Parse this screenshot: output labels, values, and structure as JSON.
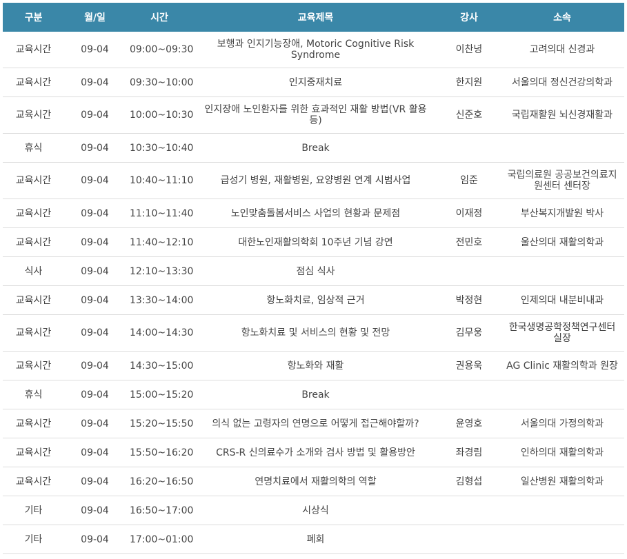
{
  "table": {
    "headers": [
      "구분",
      "월/일",
      "시간",
      "교육제목",
      "강사",
      "소속"
    ],
    "rows": [
      {
        "type": "교육시간",
        "date": "09-04",
        "time": "09:00~09:30",
        "title": "보행과 인지기능장애, Motoric Cognitive Risk Syndrome",
        "speaker": "이찬녕",
        "affiliation": "고려의대 신경과"
      },
      {
        "type": "교육시간",
        "date": "09-04",
        "time": "09:30~10:00",
        "title": "인지중재치료",
        "speaker": "한지원",
        "affiliation": "서울의대 정신건강의학과"
      },
      {
        "type": "교육시간",
        "date": "09-04",
        "time": "10:00~10:30",
        "title": "인지장애 노인환자를 위한 효과적인 재활 방법(VR 활용 등)",
        "speaker": "신준호",
        "affiliation": "국립재활원 뇌신경재활과"
      },
      {
        "type": "휴식",
        "date": "09-04",
        "time": "10:30~10:40",
        "title": "Break",
        "speaker": "",
        "affiliation": ""
      },
      {
        "type": "교육시간",
        "date": "09-04",
        "time": "10:40~11:10",
        "title": "급성기 병원, 재활병원, 요양병원 연계 시범사업",
        "speaker": "임준",
        "affiliation": "국립의료원 공공보건의료지원센터 센터장"
      },
      {
        "type": "교육시간",
        "date": "09-04",
        "time": "11:10~11:40",
        "title": "노인맞춤돌봄서비스 사업의 현황과 문제점",
        "speaker": "이재정",
        "affiliation": "부산복지개발원 박사"
      },
      {
        "type": "교육시간",
        "date": "09-04",
        "time": "11:40~12:10",
        "title": "대한노인재활의학회 10주년 기념 강연",
        "speaker": "전민호",
        "affiliation": "울산의대 재활의학과"
      },
      {
        "type": "식사",
        "date": "09-04",
        "time": "12:10~13:30",
        "title": "점심 식사",
        "speaker": "",
        "affiliation": ""
      },
      {
        "type": "교육시간",
        "date": "09-04",
        "time": "13:30~14:00",
        "title": "항노화치료, 임상적 근거",
        "speaker": "박정현",
        "affiliation": "인제의대 내분비내과"
      },
      {
        "type": "교육시간",
        "date": "09-04",
        "time": "14:00~14:30",
        "title": "항노화치료 및 서비스의 현황 및 전망",
        "speaker": "김무웅",
        "affiliation": "한국생명공학정책연구센터 실장"
      },
      {
        "type": "교육시간",
        "date": "09-04",
        "time": "14:30~15:00",
        "title": "항노화와 재활",
        "speaker": "권용욱",
        "affiliation": "AG Clinic 재활의학과 원장"
      },
      {
        "type": "휴식",
        "date": "09-04",
        "time": "15:00~15:20",
        "title": "Break",
        "speaker": "",
        "affiliation": ""
      },
      {
        "type": "교육시간",
        "date": "09-04",
        "time": "15:20~15:50",
        "title": "의식 없는 고령자의 연명으로 어떻게 접근해야할까?",
        "speaker": "윤영호",
        "affiliation": "서울의대 가정의학과"
      },
      {
        "type": "교육시간",
        "date": "09-04",
        "time": "15:50~16:20",
        "title": "CRS-R 신의료수가 소개와 검사 방법 및 활용방안",
        "speaker": "좌경림",
        "affiliation": "인하의대 재활의학과"
      },
      {
        "type": "교육시간",
        "date": "09-04",
        "time": "16:20~16:50",
        "title": "연명치료에서 재활의학의 역할",
        "speaker": "김형섭",
        "affiliation": "일산병원 재활의학과"
      },
      {
        "type": "기타",
        "date": "09-04",
        "time": "16:50~17:00",
        "title": "시상식",
        "speaker": "",
        "affiliation": ""
      },
      {
        "type": "기타",
        "date": "09-04",
        "time": "17:00~01:00",
        "title": "폐회",
        "speaker": "",
        "affiliation": ""
      }
    ]
  },
  "colors": {
    "header_bg": "#3a87a8",
    "header_text": "#ffffff",
    "body_text": "#444444",
    "row_border": "#dcdcdc"
  }
}
